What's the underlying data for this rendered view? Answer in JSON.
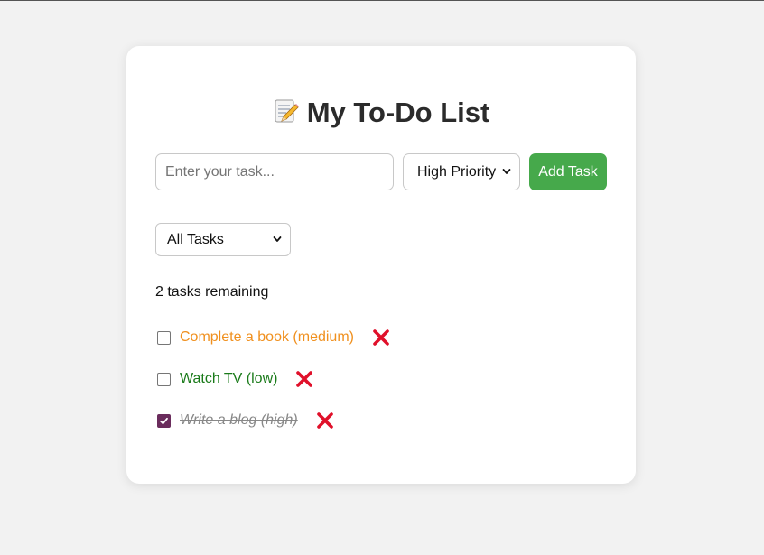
{
  "app": {
    "title": "My To-Do List"
  },
  "task_input": {
    "placeholder": "Enter your task...",
    "value": ""
  },
  "priority_select": {
    "selected": "High Priority"
  },
  "add_button": {
    "label": "Add Task"
  },
  "filter_select": {
    "selected": "All Tasks"
  },
  "status": {
    "remaining_text": "2 tasks remaining"
  },
  "tasks": [
    {
      "text": "Complete a book (medium)",
      "completed": false,
      "color": "#f0901e"
    },
    {
      "text": "Watch TV (low)",
      "completed": false,
      "color": "#197a19"
    },
    {
      "text": "Write a blog (high)",
      "completed": true,
      "color": "#888888"
    }
  ],
  "colors": {
    "accent": "#46a94b",
    "delete": "#e0102a",
    "checkbox_checked": "#6a2c5c",
    "page_bg": "#f2f2f2"
  },
  "icons": {
    "title_icon": "memo-pencil-icon",
    "delete_icon": "close-x-icon",
    "select_icon": "chevron-down-icon"
  }
}
